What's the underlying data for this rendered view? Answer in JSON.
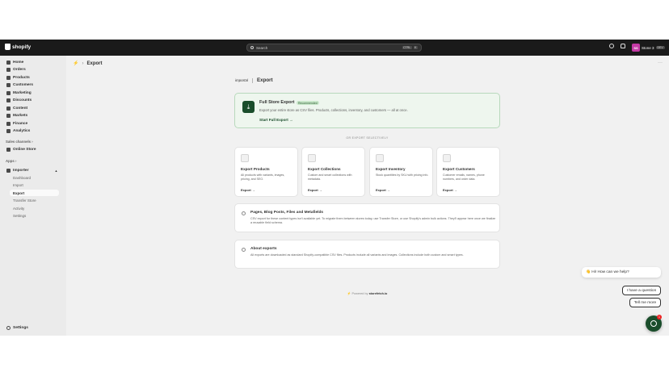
{
  "topbar": {
    "logo": "shopify",
    "search_placeholder": "Search",
    "shortcut_keys": [
      "CTRL",
      "K"
    ],
    "store_initials": "SS",
    "store_name": "Stone 3",
    "store_tag": "DEV"
  },
  "sidebar": {
    "items": [
      {
        "label": "Home",
        "icon": "home-icon"
      },
      {
        "label": "Orders",
        "icon": "orders-icon"
      },
      {
        "label": "Products",
        "icon": "tag-icon"
      },
      {
        "label": "Customers",
        "icon": "person-icon"
      },
      {
        "label": "Marketing",
        "icon": "target-icon"
      },
      {
        "label": "Discounts",
        "icon": "discount-icon"
      },
      {
        "label": "Content",
        "icon": "content-icon"
      },
      {
        "label": "Markets",
        "icon": "globe-icon"
      },
      {
        "label": "Finance",
        "icon": "bank-icon"
      },
      {
        "label": "Analytics",
        "icon": "chart-icon"
      }
    ],
    "sales_channels_label": "Sales channels",
    "online_store": "Online Store",
    "apps_label": "Apps",
    "app_name": "Importer",
    "app_sub": [
      "Dashboard",
      "Import",
      "Export",
      "Transfer Store",
      "Activity",
      "Settings"
    ],
    "settings": "Settings"
  },
  "page": {
    "title": "Export",
    "brand": "importal",
    "brand_title": "Export"
  },
  "hero": {
    "title": "Full Store Export",
    "badge": "Recommended",
    "description": "Export your entire store as CSV files. Products, collections, inventory, and customers — all at once.",
    "cta": "Start Full Export →"
  },
  "or_text": "OR EXPORT SELECTIVELY",
  "cards": [
    {
      "title": "Export Products",
      "desc": "All products with variants, images, pricing, and SEO.",
      "link": "Export →"
    },
    {
      "title": "Export Collections",
      "desc": "Custom and smart collections with metadata.",
      "link": "Export →"
    },
    {
      "title": "Export Inventory",
      "desc": "Stock quantities by SKU with pricing info.",
      "link": "Export →"
    },
    {
      "title": "Export Customers",
      "desc": "Customer emails, names, phone numbers, and order data.",
      "link": "Export →"
    }
  ],
  "info1": {
    "title": "Pages, Blog Posts, Files and Metafields",
    "desc": "CSV export for these content types isn't available yet. To migrate them between stores today, use Transfer Store, or use Shopify's admin bulk actions. They'll appear here once we finalize a reusable field schema."
  },
  "info2": {
    "title": "About exports",
    "desc": "All exports are downloaded as standard Shopify-compatible CSV files. Products include all variants and images. Collections include both custom and smart types."
  },
  "footer": {
    "prefix": "Powered by",
    "name": "storefetch.io"
  },
  "chat": {
    "greeting": "👋 Hi! How can we help?",
    "question": "I have a question",
    "more": "Tell me more",
    "badge": "1"
  }
}
